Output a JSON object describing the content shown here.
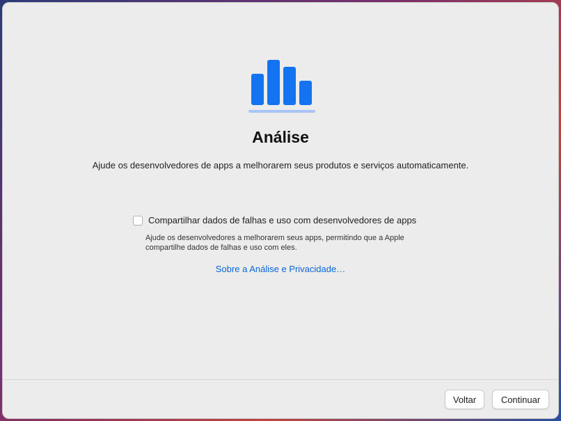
{
  "page": {
    "title": "Análise",
    "subtitle": "Ajude os desenvolvedores de apps a melhorarem seus produtos e serviços automaticamente."
  },
  "hero_icon": {
    "name": "bar-chart-icon",
    "bar_color": "#1473f0",
    "underline_color": "#a9c6f2"
  },
  "option": {
    "label": "Compartilhar dados de falhas e uso com desenvolvedores de apps",
    "checked": false,
    "description_line1": "Ajude os desenvolvedores a melhorarem seus apps, permitindo que a Apple",
    "description_line2": "compartilhe dados de falhas e uso com eles."
  },
  "link": {
    "label": "Sobre a Análise e Privacidade…"
  },
  "buttons": {
    "back": "Voltar",
    "continue": "Continuar"
  }
}
